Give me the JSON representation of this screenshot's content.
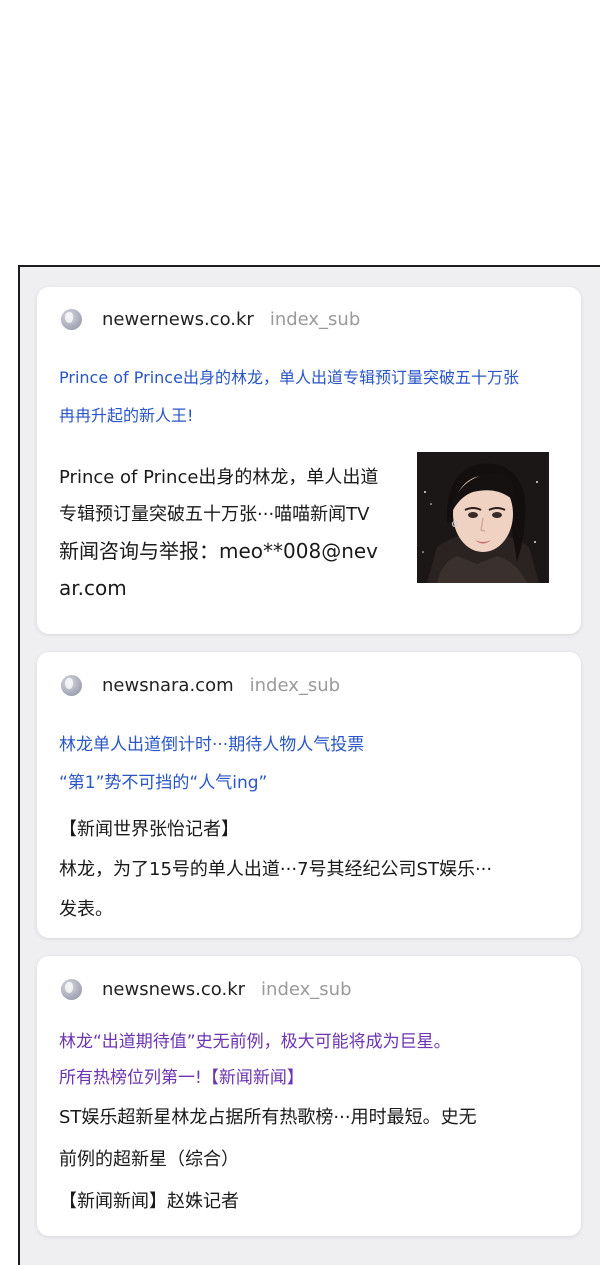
{
  "cards": [
    {
      "domain": "newernews.co.kr",
      "tag": "index_sub",
      "headline_lines": [
        "Prince of Prince出身的林龙，单人出道专辑预订量突破五十万张",
        "冉冉升起的新人王!"
      ],
      "body_lines": [
        "Prince of Prince出身的林龙，单人出道",
        "专辑预订量突破五十万张···喵喵新闻TV",
        "新闻咨询与举报：meo**008@nev",
        "ar.com"
      ],
      "headline_color": "#2a56c6"
    },
    {
      "domain": "newsnara.com",
      "tag": "index_sub",
      "headline_lines": [
        "林龙单人出道倒计时···期待人物人气投票",
        "“第1”势不可挡的“人气ing”"
      ],
      "body_lines": [
        "【新闻世界张怡记者】",
        "林龙，为了15号的单人出道···7号其经纪公司ST娱乐···",
        "发表。"
      ],
      "headline_color": "#2a56c6"
    },
    {
      "domain": "newsnews.co.kr",
      "tag": "index_sub",
      "headline_lines": [
        "林龙“出道期待值”史无前例，极大可能将成为巨星。",
        "所有热榜位列第一!【新闻新闻】"
      ],
      "body_lines": [
        "ST娱乐超新星林龙占据所有热歌榜···用时最短。史无",
        "前例的超新星（综合）",
        "【新闻新闻】赵姝记者"
      ],
      "headline_color": "#6c34b0"
    }
  ],
  "icons": {
    "source": "globe-icon",
    "thumbnail": "portrait-thumbnail"
  }
}
